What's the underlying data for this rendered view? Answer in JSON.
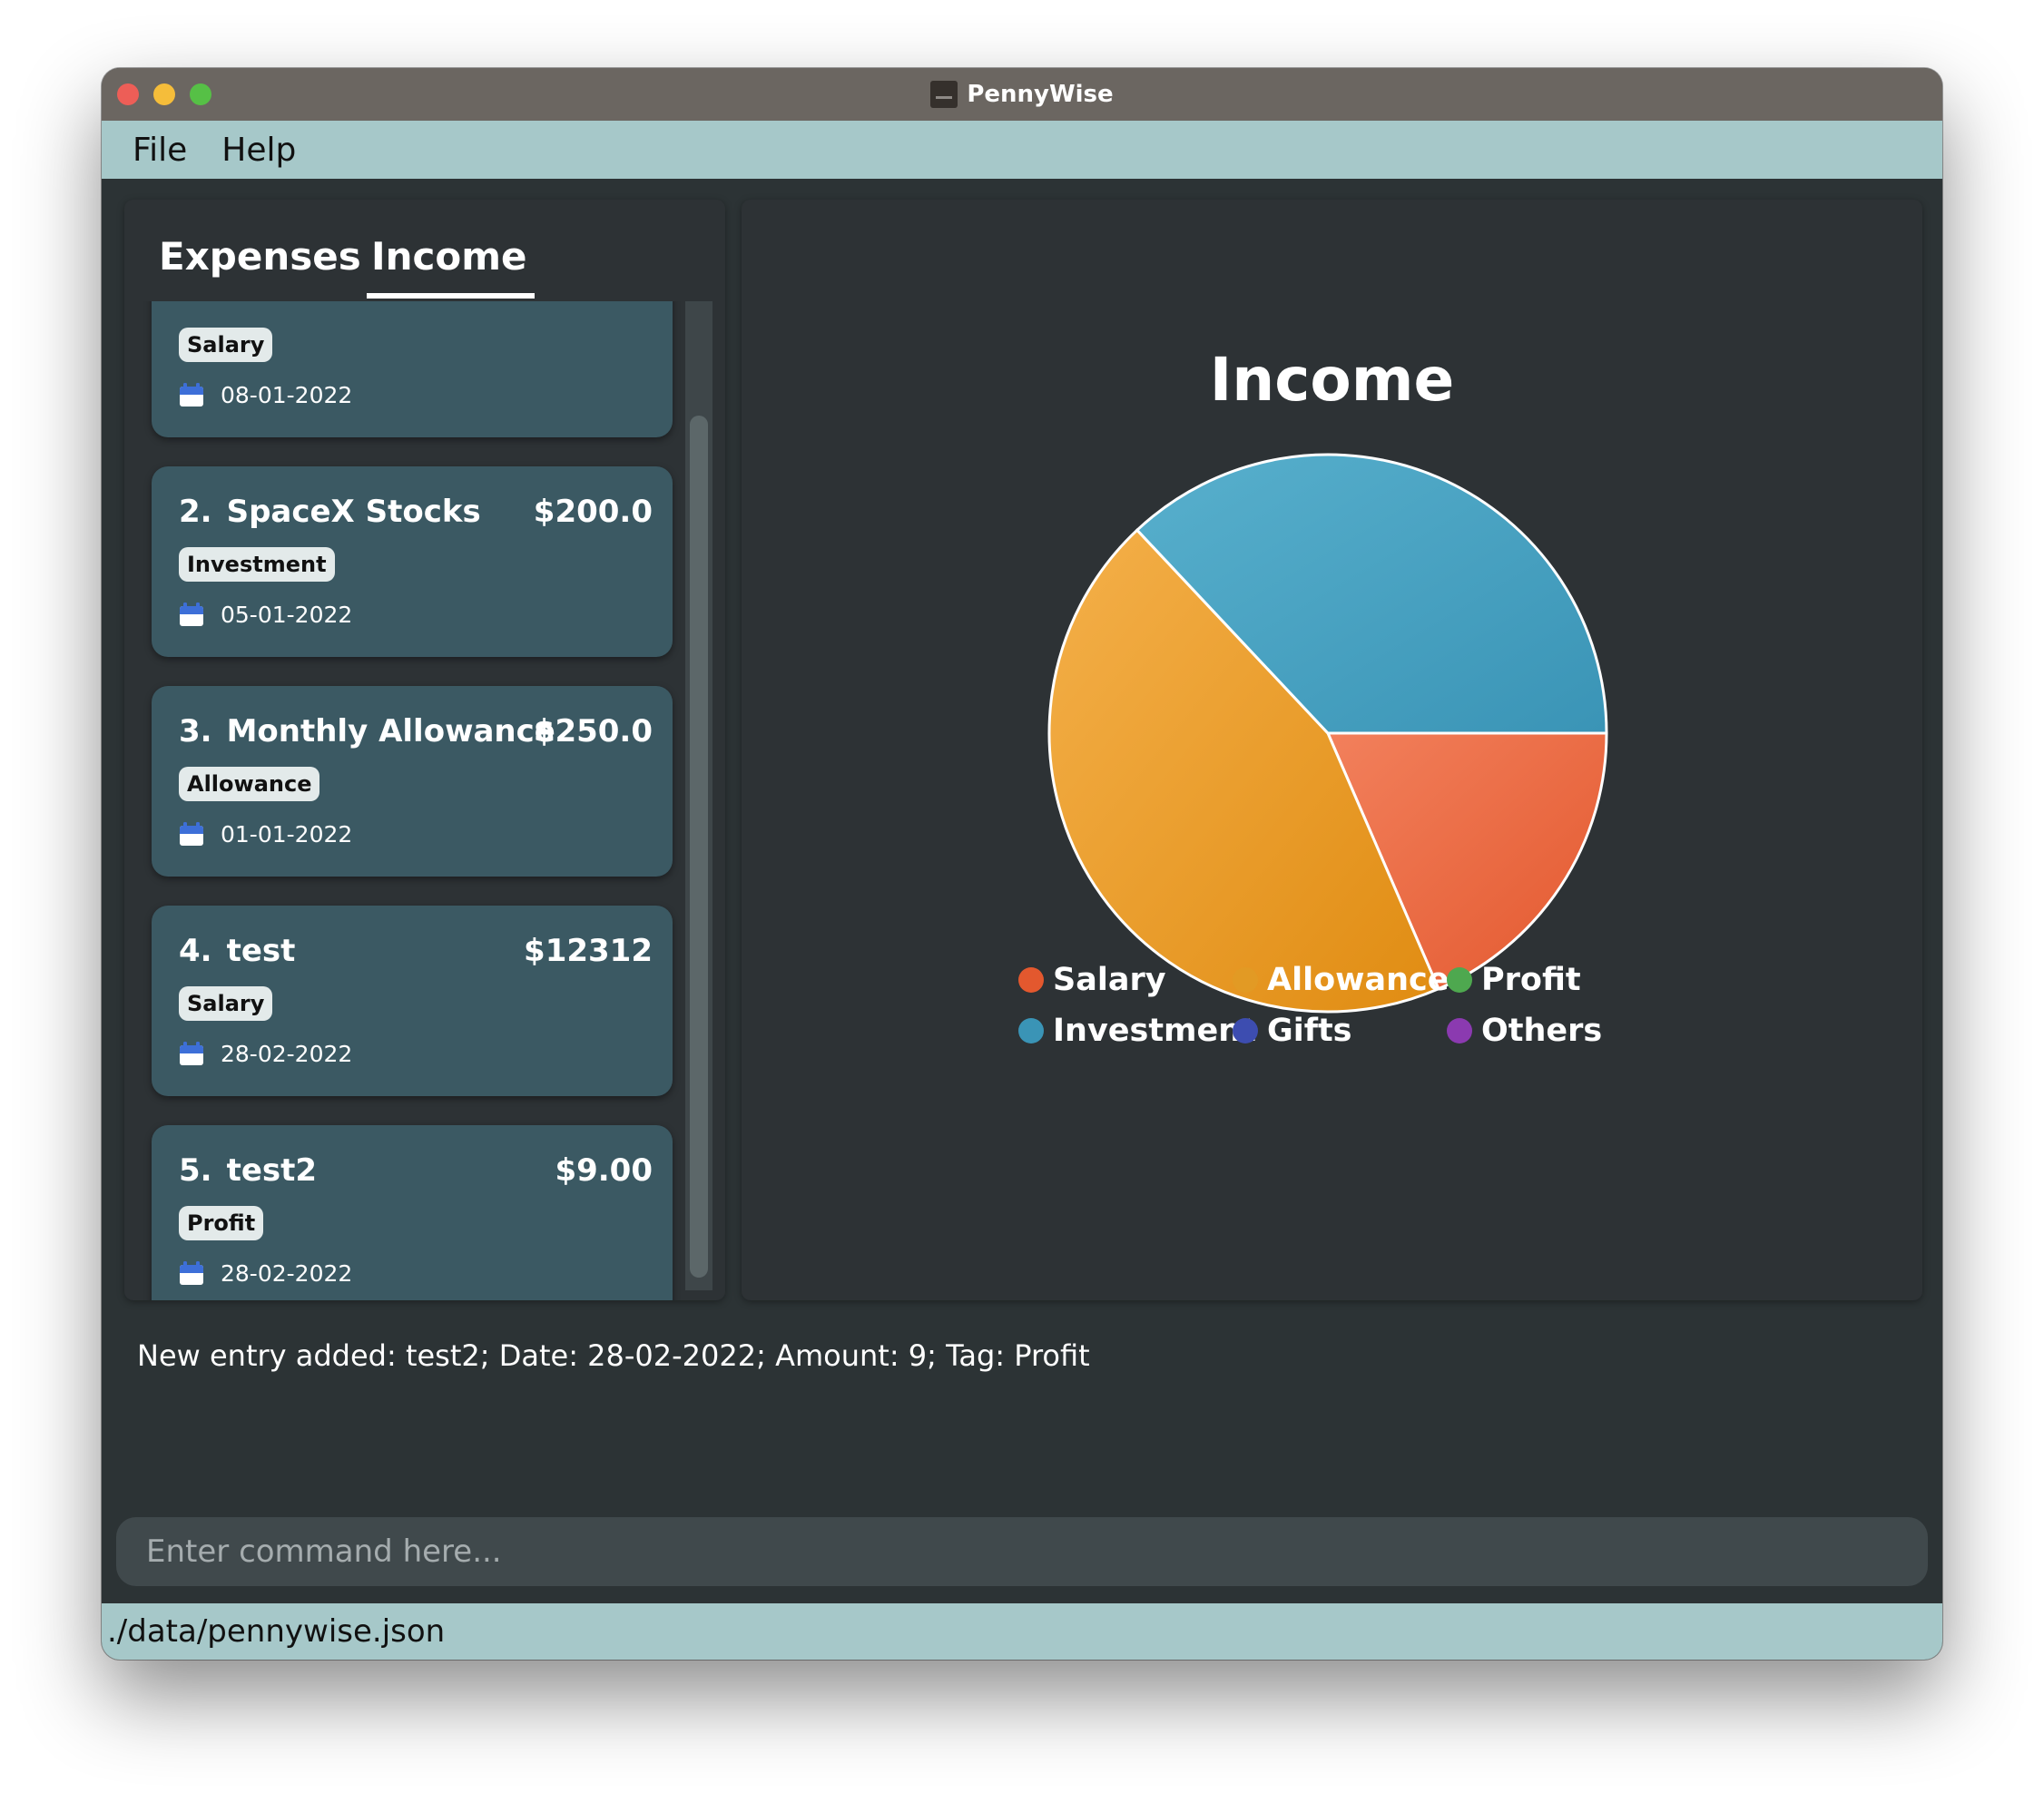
{
  "window": {
    "title": "PennyWise"
  },
  "menu": {
    "file": "File",
    "help": "Help"
  },
  "tabs": {
    "expenses": "Expenses",
    "income": "Income",
    "active": "Income"
  },
  "entries": [
    {
      "index": "",
      "description": "",
      "amount": "",
      "tag": "Salary",
      "date": "08-01-2022"
    },
    {
      "index": "2.",
      "description": "SpaceX Stocks",
      "amount": "$200.0",
      "tag": "Investment",
      "date": "05-01-2022"
    },
    {
      "index": "3.",
      "description": "Monthly Allowance",
      "amount": "$250.0",
      "tag": "Allowance",
      "date": "01-01-2022"
    },
    {
      "index": "4.",
      "description": "test",
      "amount": "$12312",
      "tag": "Salary",
      "date": "28-02-2022"
    },
    {
      "index": "5.",
      "description": "test2",
      "amount": "$9.00",
      "tag": "Profit",
      "date": "28-02-2022"
    }
  ],
  "chart_data": {
    "type": "pie",
    "title": "Income",
    "slices": [
      {
        "label": "Salary",
        "percent": 18.5,
        "color": "#e3582e",
        "colorLight": "#f2805c"
      },
      {
        "label": "Allowance",
        "percent": 44.5,
        "color": "#e08c12",
        "colorLight": "#f4b04a"
      },
      {
        "label": "Investment",
        "percent": 37.0,
        "color": "#3a94b6",
        "colorLight": "#58b0cd"
      }
    ],
    "legend": [
      {
        "label": "Salary",
        "color": "#e3582e"
      },
      {
        "label": "Allowance",
        "color": "#e29a24"
      },
      {
        "label": "Profit",
        "color": "#4ea84f"
      },
      {
        "label": "Investment",
        "color": "#3a94b6"
      },
      {
        "label": "Gifts",
        "color": "#3d4db0"
      },
      {
        "label": "Others",
        "color": "#8b3ab0"
      }
    ],
    "legend_placement": "bottom"
  },
  "result": {
    "message": "New entry added: test2; Date: 28-02-2022; Amount: 9; Tag: Profit"
  },
  "command": {
    "placeholder": "Enter command here...",
    "value": ""
  },
  "status": {
    "file_path": "./data/pennywise.json"
  }
}
